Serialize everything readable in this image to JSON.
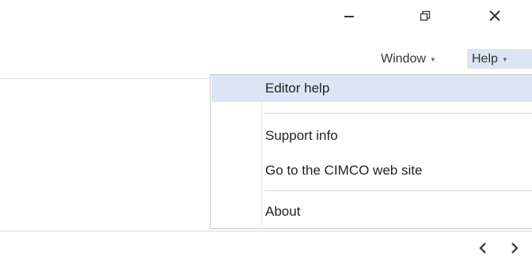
{
  "window_controls": {
    "minimize": "minimize-icon",
    "restore": "restore-icon",
    "close": "close-icon"
  },
  "menubar": {
    "window_label": "Window",
    "help_label": "Help"
  },
  "help_menu": {
    "items": [
      {
        "label": "Editor help",
        "highlighted": true
      },
      {
        "label": "Support info",
        "highlighted": false
      },
      {
        "label": "Go to the CIMCO web site",
        "highlighted": false
      },
      {
        "label": "About",
        "highlighted": false
      }
    ]
  },
  "navigation": {
    "prev": "chevron-left-icon",
    "next": "chevron-right-icon"
  },
  "colors": {
    "highlight": "#dbe5f3",
    "separator": "#d4d4d4",
    "icon": "#333333"
  }
}
